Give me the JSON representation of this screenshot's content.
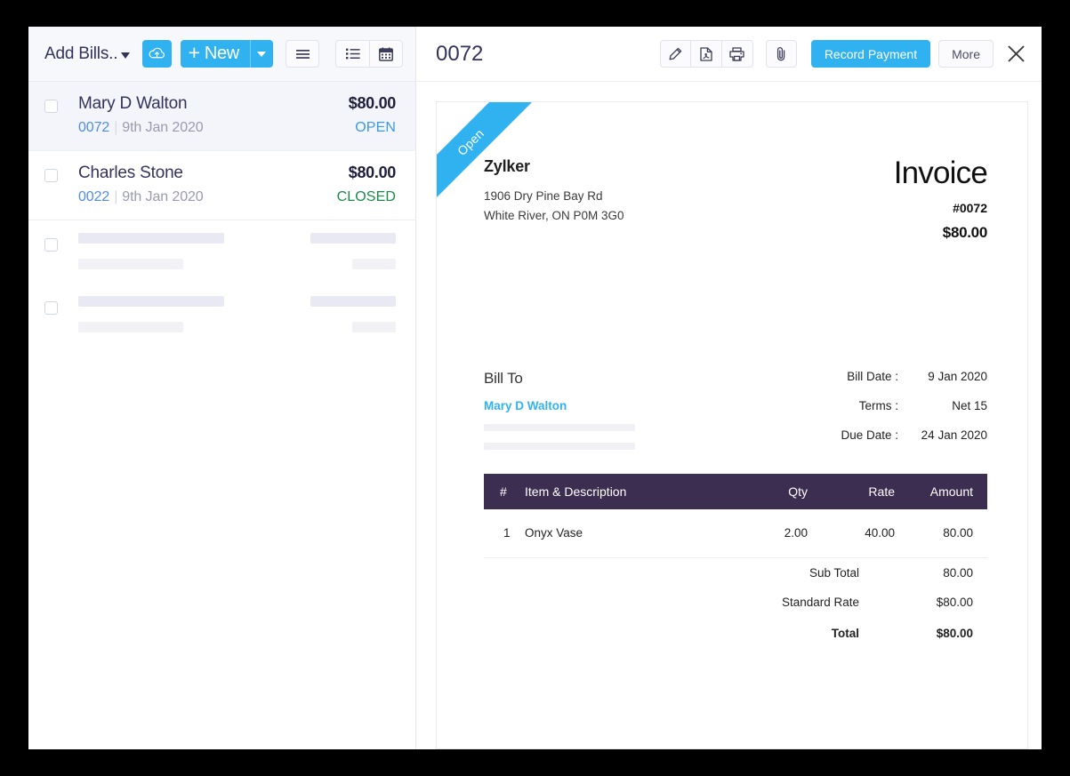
{
  "sidebar": {
    "toolbar": {
      "add_label": "Add Bills..",
      "new_label": "New",
      "plus": "+",
      "import_icon": "cloud-upload-icon",
      "new_caret_icon": "chevron-down-icon",
      "view_compact_icon": "list-lines-icon",
      "view_detail_icon": "bulleted-list-icon",
      "view_calendar_icon": "calendar-icon"
    },
    "rows": [
      {
        "name": "Mary D Walton",
        "amount": "$80.00",
        "number": "0072",
        "separator": "|",
        "date": "9th Jan 2020",
        "status": "OPEN",
        "status_kind": "open",
        "selected": true
      },
      {
        "name": "Charles Stone",
        "amount": "$80.00",
        "number": "0022",
        "separator": "|",
        "date": "9th Jan 2020",
        "status": "CLOSED",
        "status_kind": "closed",
        "selected": false
      }
    ],
    "skeleton_rows": 2
  },
  "detail": {
    "title": "0072",
    "actions": {
      "edit_icon": "pencil-icon",
      "pdf_icon": "pdf-file-icon",
      "print_icon": "printer-icon",
      "attach_icon": "paperclip-icon",
      "record_payment_label": "Record Payment",
      "more_label": "More",
      "close_icon": "close-icon"
    }
  },
  "invoice": {
    "ribbon": "Open",
    "org_name": "Zylker",
    "org_address_line1": "1906 Dry Pine Bay Rd",
    "org_address_line2": "White River, ON P0M 3G0",
    "doc_word": "Invoice",
    "doc_number": "#0072",
    "doc_amount": "$80.00",
    "bill_to_label": "Bill To",
    "bill_to_name": "Mary D Walton",
    "meta": [
      {
        "key": "Bill Date :",
        "value": "9 Jan 2020"
      },
      {
        "key": "Terms :",
        "value": "Net 15"
      },
      {
        "key": "Due Date :",
        "value": "24 Jan 2020"
      }
    ],
    "table": {
      "headers": {
        "idx": "#",
        "desc": "Item & Description",
        "qty": "Qty",
        "rate": "Rate",
        "amount": "Amount"
      },
      "rows": [
        {
          "idx": "1",
          "desc": "Onyx Vase",
          "qty": "2.00",
          "rate": "40.00",
          "amount": "80.00"
        }
      ]
    },
    "totals": [
      {
        "key": "Sub Total",
        "value": "80.00",
        "grand": false
      },
      {
        "key": "Standard Rate",
        "value": "$80.00",
        "grand": false
      },
      {
        "key": "Total",
        "value": "$80.00",
        "grand": true
      }
    ]
  },
  "colors": {
    "accent_blue": "#31b2f0",
    "table_header": "#3b2e50",
    "status_open": "#3b9ae8",
    "status_closed": "#1a8a4a",
    "text_dark": "#33335c"
  }
}
